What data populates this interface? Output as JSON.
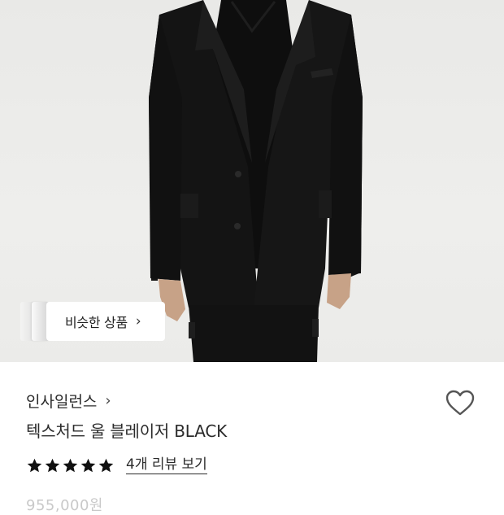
{
  "product_image": {
    "alt": "model wearing black textured wool blazer",
    "background": "#ebebe9",
    "garment_color": "#131313"
  },
  "similar": {
    "label": "비슷한 상품",
    "chevron_icon": "chevron-right-icon"
  },
  "brand": {
    "name": "인사일런스",
    "chevron_icon": "chevron-right-icon"
  },
  "wishlist": {
    "icon": "heart-outline-icon"
  },
  "product": {
    "title": "텍스처드 울 블레이저 BLACK"
  },
  "rating": {
    "stars": 5,
    "max": 5,
    "reviews_link": "4개 리뷰 보기"
  },
  "price": {
    "partial": "955,000원"
  }
}
